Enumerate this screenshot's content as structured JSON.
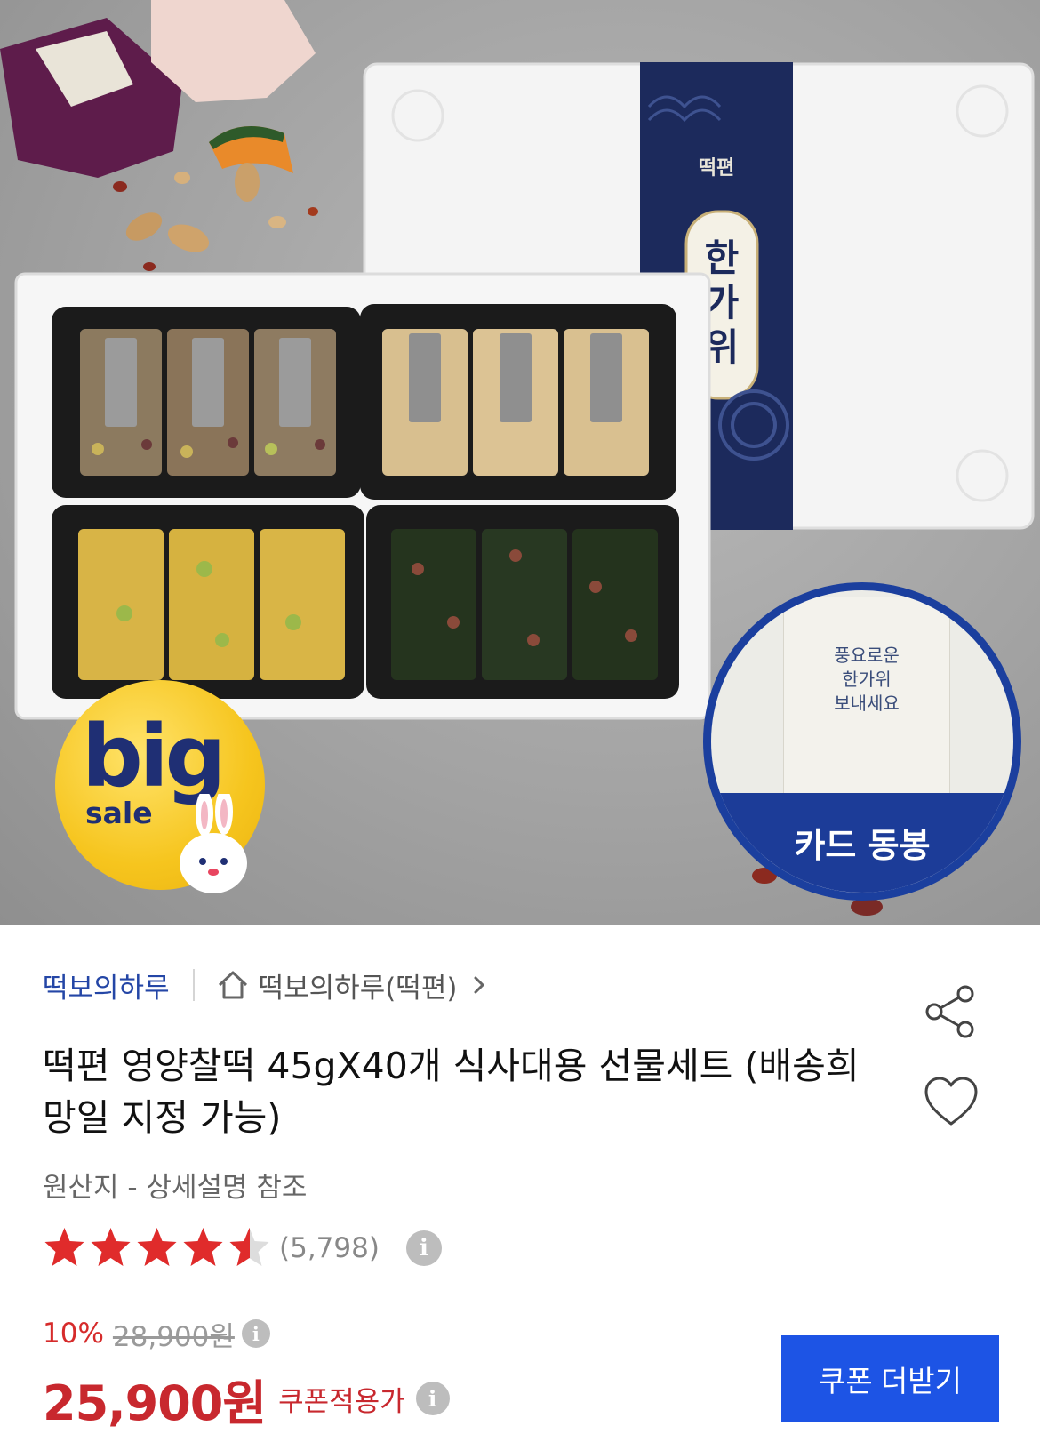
{
  "hero": {
    "badge_big": {
      "big_text": "big",
      "sale_text": "sale"
    },
    "card_overlay": {
      "card_lines": [
        "풍요로운",
        "한가위",
        "보내세요"
      ],
      "band_label": "카드 동봉"
    },
    "box_band_text": "한가위",
    "box_brand_text": "떡편"
  },
  "store": {
    "brand_label": "떡보의하루",
    "store_link_label": "떡보의하루(떡편)"
  },
  "product": {
    "title": "떡편 영양찰떡 45gX40개 식사대용 선물세트 (배송희망일 지정 가능)",
    "origin": "원산지 - 상세설명 참조",
    "rating": {
      "stars": 4.5,
      "max": 5,
      "review_count": "(5,798)"
    },
    "discount_rate": "10%",
    "original_price": "28,900원",
    "sale_price": "25,900원",
    "price_label": "쿠폰적용가",
    "info_glyph": "i"
  },
  "actions": {
    "coupon_button_label": "쿠폰 더받기"
  },
  "colors": {
    "brand_blue": "#2446a6",
    "price_red": "#c8282e",
    "discount_red": "#d62b2b",
    "button_blue": "#1d54e5",
    "star_red": "#e02b2b",
    "badge_yellow": "#f6c51e",
    "card_band_blue": "#1c3c98"
  },
  "icons": [
    "home-icon",
    "chevron-right-icon",
    "share-icon",
    "heart-icon",
    "star-icon",
    "info-icon"
  ]
}
